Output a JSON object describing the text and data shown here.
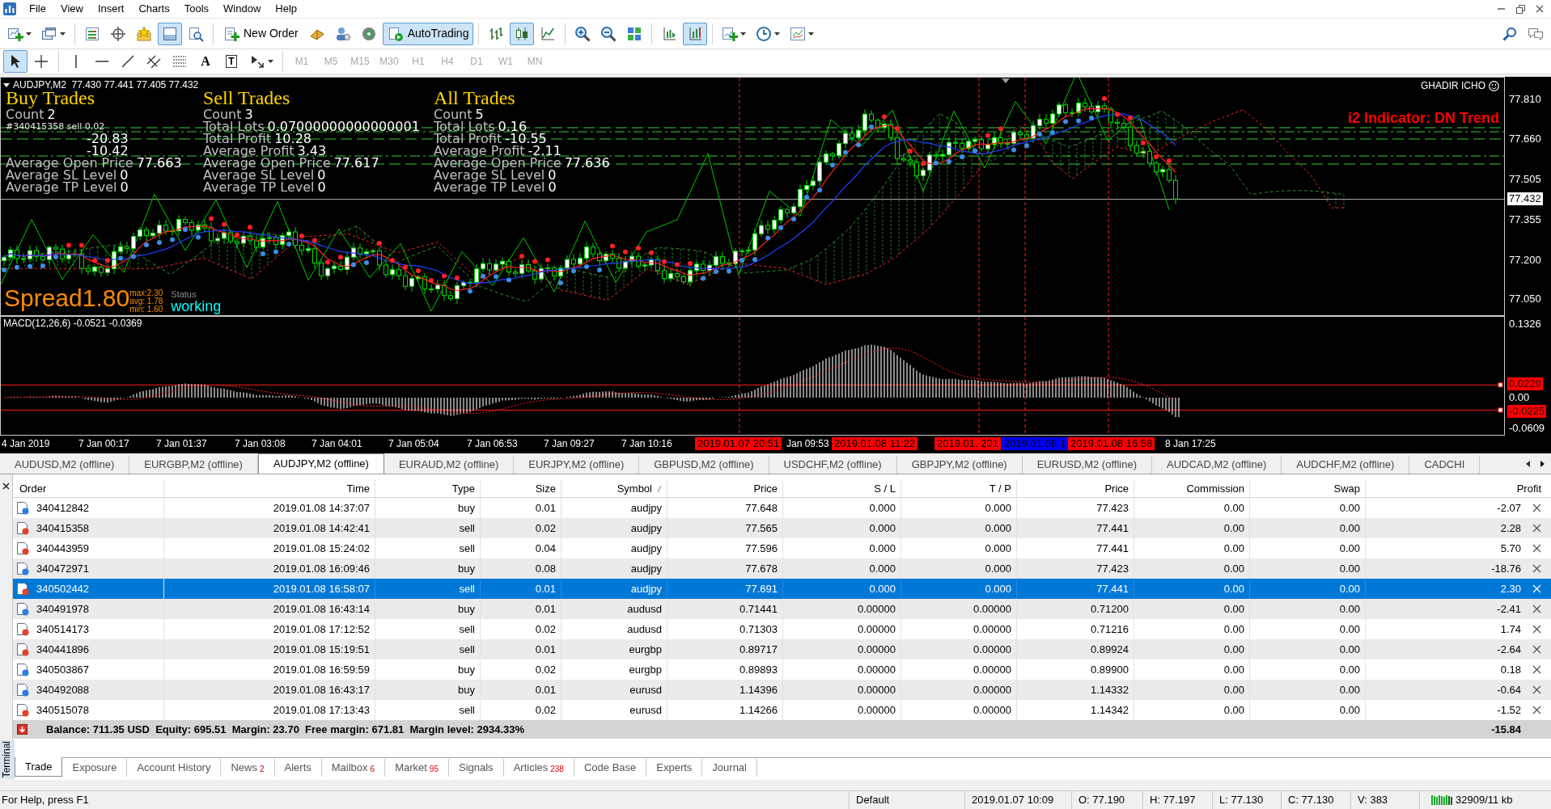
{
  "menu": [
    "File",
    "View",
    "Insert",
    "Charts",
    "Tools",
    "Window",
    "Help"
  ],
  "toolbar": {
    "new_order": "New Order",
    "auto_trading": {
      "label": "AutoTrading",
      "on": true
    },
    "terminal": {
      "on": true
    },
    "chart_modes": [
      {
        "selected": false
      },
      {
        "selected": true
      },
      {
        "selected": false
      }
    ],
    "auto_scroll": {
      "on": true
    }
  },
  "line_studies": [
    {
      "selected": true
    },
    {
      "selected": false
    },
    {
      "selected": false
    },
    {
      "selected": false
    },
    {
      "selected": false
    },
    {
      "selected": false
    },
    {
      "selected": false
    },
    {
      "selected": false,
      "glyph": "A"
    },
    {
      "selected": false,
      "glyph": "T"
    },
    {
      "selected": false
    }
  ],
  "timeframes": [
    {
      "label": "M1",
      "disabled": true
    },
    {
      "label": "M5",
      "disabled": true
    },
    {
      "label": "M15",
      "disabled": true
    },
    {
      "label": "M30",
      "disabled": true
    },
    {
      "label": "H1",
      "disabled": true
    },
    {
      "label": "H4",
      "disabled": true
    },
    {
      "label": "D1",
      "disabled": true
    },
    {
      "label": "W1",
      "disabled": true
    },
    {
      "label": "MN",
      "disabled": true
    }
  ],
  "chart": {
    "header": "AUDJPY,M2  77.430 77.441 77.405 77.432",
    "expert": "GHADIR ICHO",
    "signal": "i2 Indicator: DN Trend",
    "stats": [
      {
        "title": "Buy Trades",
        "lines": [
          {
            "kind": "stat",
            "label": "Count",
            "value": "2"
          },
          {
            "kind": "order",
            "text": "#340415358 sell 0.02"
          },
          {
            "kind": "stat",
            "value": "-20.83"
          },
          {
            "kind": "stat",
            "value": "-10.42"
          },
          {
            "kind": "stat",
            "label": "Average Open Price",
            "value": "77.663"
          },
          {
            "kind": "stat",
            "label": "Average SL Level",
            "value": "0"
          },
          {
            "kind": "stat",
            "label": "Average TP Level",
            "value": "0"
          }
        ]
      },
      {
        "title": "Sell Trades",
        "lines": [
          {
            "kind": "stat",
            "label": "Count",
            "value": "3"
          },
          {
            "kind": "stat",
            "label": "Total Lots",
            "value": "0.07000000000000001"
          },
          {
            "kind": "stat",
            "label": "Total Profit",
            "value": "10.28"
          },
          {
            "kind": "stat",
            "label": "Average Profit",
            "value": "3.43"
          },
          {
            "kind": "stat",
            "label": "Average Open Price",
            "value": "77.617"
          },
          {
            "kind": "stat",
            "label": "Average SL Level",
            "value": "0"
          },
          {
            "kind": "stat",
            "label": "Average TP Level",
            "value": "0"
          }
        ]
      },
      {
        "title": "All Trades",
        "lines": [
          {
            "kind": "stat",
            "label": "Count",
            "value": "5"
          },
          {
            "kind": "stat",
            "label": "Total Lots",
            "value": "0.16"
          },
          {
            "kind": "stat",
            "label": "Total Profit",
            "value": "-10.55"
          },
          {
            "kind": "stat",
            "label": "Average Profit",
            "value": "-2.11"
          },
          {
            "kind": "stat",
            "label": "Average Open Price",
            "value": "77.636"
          },
          {
            "kind": "stat",
            "label": "Average SL Level",
            "value": "0"
          },
          {
            "kind": "stat",
            "label": "Average TP Level",
            "value": "0"
          }
        ]
      }
    ],
    "spread": {
      "value": "Spread1.80",
      "max": "max:2.30",
      "avg": "avg: 1.78",
      "min": "min: 1.60"
    },
    "status": {
      "label": "Status",
      "value": "working"
    },
    "price_axis": [
      {
        "text": "77.810",
        "current": false
      },
      {
        "text": "77.660",
        "current": false
      },
      {
        "text": "77.505",
        "current": false
      },
      {
        "text": "77.432",
        "current": true
      },
      {
        "text": "77.355",
        "current": false
      },
      {
        "text": "77.200",
        "current": false
      },
      {
        "text": "77.050",
        "current": false
      }
    ],
    "macd": {
      "label": "MACD(12,26,6) -0.0521 -0.0369",
      "axis": [
        {
          "text": "0.1326",
          "highlighted": false
        },
        {
          "text": "0.0229",
          "highlighted": true
        },
        {
          "text": "0.00",
          "highlighted": false
        },
        {
          "text": "-0.0225",
          "highlighted": true
        },
        {
          "text": "-0.0609",
          "highlighted": false
        }
      ]
    },
    "time_axis": [
      {
        "text": "4 Jan 2019"
      },
      {
        "text": "7 Jan 00:17"
      },
      {
        "text": "7 Jan 01:37"
      },
      {
        "text": "7 Jan 03:08"
      },
      {
        "text": "7 Jan 04:01"
      },
      {
        "text": "7 Jan 05:04"
      },
      {
        "text": "7 Jan 06:53"
      },
      {
        "text": "7 Jan 09:27"
      },
      {
        "text": "7 Jan 10:16"
      },
      {
        "text": "2019.01.07 20:51",
        "color": "#ff0000"
      },
      {
        "text": "Jan 09:53"
      },
      {
        "text": "2019.01.08 11:22",
        "color": "#ff0000"
      },
      {
        "text": "2019.01. 201",
        "color": "#ff0000"
      },
      {
        "text": "2019.01.08 1",
        "color": "#0000ff"
      },
      {
        "text": "2019.01.08 16:58",
        "color": "#ff0000"
      },
      {
        "text": "8 Jan 17:25"
      }
    ]
  },
  "chart_tabs": [
    {
      "label": "AUDUSD,M2 (offline)",
      "selected": false
    },
    {
      "label": "EURGBP,M2 (offline)",
      "selected": false
    },
    {
      "label": "AUDJPY,M2 (offline)",
      "selected": true
    },
    {
      "label": "EURAUD,M2 (offline)",
      "selected": false
    },
    {
      "label": "EURJPY,M2 (offline)",
      "selected": false
    },
    {
      "label": "GBPUSD,M2 (offline)",
      "selected": false
    },
    {
      "label": "USDCHF,M2 (offline)",
      "selected": false
    },
    {
      "label": "GBPJPY,M2 (offline)",
      "selected": false
    },
    {
      "label": "EURUSD,M2 (offline)",
      "selected": false
    },
    {
      "label": "AUDCAD,M2 (offline)",
      "selected": false
    },
    {
      "label": "AUDCHF,M2 (offline)",
      "selected": false
    },
    {
      "label": "CADCHI",
      "selected": false
    }
  ],
  "terminal": {
    "label": "Terminal",
    "columns": [
      "Order",
      "Time",
      "Type",
      "Size",
      "Symbol",
      "Price",
      "S / L",
      "T / P",
      "Price",
      "Commission",
      "Swap",
      "Profit"
    ],
    "rows": [
      {
        "kind": "buy",
        "selected": false,
        "cells": [
          "340412842",
          "2019.01.08 14:37:07",
          "buy",
          "0.01",
          "audjpy",
          "77.648",
          "0.000",
          "0.000",
          "77.423",
          "0.00",
          "0.00",
          "-2.07"
        ]
      },
      {
        "kind": "sell",
        "selected": false,
        "cells": [
          "340415358",
          "2019.01.08 14:42:41",
          "sell",
          "0.02",
          "audjpy",
          "77.565",
          "0.000",
          "0.000",
          "77.441",
          "0.00",
          "0.00",
          "2.28"
        ]
      },
      {
        "kind": "sell",
        "selected": false,
        "cells": [
          "340443959",
          "2019.01.08 15:24:02",
          "sell",
          "0.04",
          "audjpy",
          "77.596",
          "0.000",
          "0.000",
          "77.441",
          "0.00",
          "0.00",
          "5.70"
        ]
      },
      {
        "kind": "buy",
        "selected": false,
        "cells": [
          "340472971",
          "2019.01.08 16:09:46",
          "buy",
          "0.08",
          "audjpy",
          "77.678",
          "0.000",
          "0.000",
          "77.423",
          "0.00",
          "0.00",
          "-18.76"
        ]
      },
      {
        "kind": "sell",
        "selected": true,
        "cells": [
          "340502442",
          "2019.01.08 16:58:07",
          "sell",
          "0.01",
          "audjpy",
          "77.691",
          "0.000",
          "0.000",
          "77.441",
          "0.00",
          "0.00",
          "2.30"
        ]
      },
      {
        "kind": "buy",
        "selected": false,
        "cells": [
          "340491978",
          "2019.01.08 16:43:14",
          "buy",
          "0.01",
          "audusd",
          "0.71441",
          "0.00000",
          "0.00000",
          "0.71200",
          "0.00",
          "0.00",
          "-2.41"
        ]
      },
      {
        "kind": "sell",
        "selected": false,
        "cells": [
          "340514173",
          "2019.01.08 17:12:52",
          "sell",
          "0.02",
          "audusd",
          "0.71303",
          "0.00000",
          "0.00000",
          "0.71216",
          "0.00",
          "0.00",
          "1.74"
        ]
      },
      {
        "kind": "sell",
        "selected": false,
        "cells": [
          "340441896",
          "2019.01.08 15:19:51",
          "sell",
          "0.01",
          "eurgbp",
          "0.89717",
          "0.00000",
          "0.00000",
          "0.89924",
          "0.00",
          "0.00",
          "-2.64"
        ]
      },
      {
        "kind": "buy",
        "selected": false,
        "cells": [
          "340503867",
          "2019.01.08 16:59:59",
          "buy",
          "0.02",
          "eurgbp",
          "0.89893",
          "0.00000",
          "0.00000",
          "0.89900",
          "0.00",
          "0.00",
          "0.18"
        ]
      },
      {
        "kind": "buy",
        "selected": false,
        "cells": [
          "340492088",
          "2019.01.08 16:43:17",
          "buy",
          "0.01",
          "eurusd",
          "1.14396",
          "0.00000",
          "0.00000",
          "1.14332",
          "0.00",
          "0.00",
          "-0.64"
        ]
      },
      {
        "kind": "sell",
        "selected": false,
        "cells": [
          "340515078",
          "2019.01.08 17:13:43",
          "sell",
          "0.02",
          "eurusd",
          "1.14266",
          "0.00000",
          "0.00000",
          "1.14342",
          "0.00",
          "0.00",
          "-1.52"
        ]
      }
    ],
    "summary": {
      "text": "Balance: 711.35 USD  Equity: 695.51  Margin: 23.70  Free margin: 671.81  Margin level: 2934.33%",
      "profit": "-15.84"
    },
    "tabs": [
      {
        "label": "Trade",
        "selected": true
      },
      {
        "label": "Exposure",
        "selected": false
      },
      {
        "label": "Account History",
        "selected": false
      },
      {
        "label": "News",
        "badge": "2",
        "selected": false
      },
      {
        "label": "Alerts",
        "selected": false
      },
      {
        "label": "Mailbox",
        "badge": "6",
        "selected": false
      },
      {
        "label": "Market",
        "badge": "95",
        "selected": false
      },
      {
        "label": "Signals",
        "selected": false
      },
      {
        "label": "Articles",
        "badge": "238",
        "selected": false
      },
      {
        "label": "Code Base",
        "selected": false
      },
      {
        "label": "Experts",
        "selected": false
      },
      {
        "label": "Journal",
        "selected": false
      }
    ]
  },
  "status_bar": [
    "For Help, press F1",
    "Default",
    "2019.01.07 10:09",
    "O: 77.190",
    "H: 77.197",
    "L: 77.130",
    "C: 77.130",
    "V: 383",
    "32909/11 kb"
  ]
}
